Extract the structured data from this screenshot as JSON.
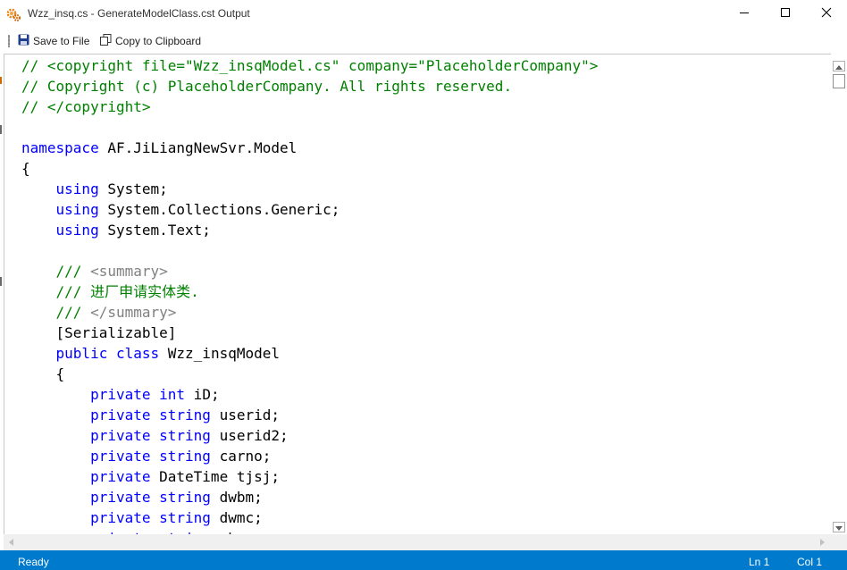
{
  "window": {
    "title": "Wzz_insq.cs - GenerateModelClass.cst Output",
    "icon": "gears-icon",
    "controls": [
      "minimize-icon",
      "maximize-icon",
      "close-icon"
    ]
  },
  "toolbar": {
    "save_label": "Save to File",
    "save_icon": "floppy-disk-icon",
    "copy_label": "Copy to Clipboard",
    "copy_icon": "copy-icon"
  },
  "editor": {
    "lines": [
      [
        {
          "t": "// <copyright file=\"Wzz_insqModel.cs\" company=\"PlaceholderCompany\">",
          "c": "c"
        }
      ],
      [
        {
          "t": "// Copyright (c) PlaceholderCompany. All rights reserved.",
          "c": "c"
        }
      ],
      [
        {
          "t": "// </copyright>",
          "c": "c"
        }
      ],
      [],
      [
        {
          "t": "namespace",
          "c": "k"
        },
        {
          "t": " AF.JiLiangNewSvr.Model",
          "c": ""
        }
      ],
      [
        {
          "t": "{",
          "c": ""
        }
      ],
      [
        {
          "t": "    ",
          "c": ""
        },
        {
          "t": "using",
          "c": "k"
        },
        {
          "t": " System;",
          "c": ""
        }
      ],
      [
        {
          "t": "    ",
          "c": ""
        },
        {
          "t": "using",
          "c": "k"
        },
        {
          "t": " System.Collections.Generic;",
          "c": ""
        }
      ],
      [
        {
          "t": "    ",
          "c": ""
        },
        {
          "t": "using",
          "c": "k"
        },
        {
          "t": " System.Text;",
          "c": ""
        }
      ],
      [],
      [
        {
          "t": "    ",
          "c": ""
        },
        {
          "t": "/// ",
          "c": "c"
        },
        {
          "t": "<summary>",
          "c": "g"
        }
      ],
      [
        {
          "t": "    ",
          "c": ""
        },
        {
          "t": "/// 进厂申请实体类.",
          "c": "c"
        }
      ],
      [
        {
          "t": "    ",
          "c": ""
        },
        {
          "t": "/// ",
          "c": "c"
        },
        {
          "t": "</summary>",
          "c": "g"
        }
      ],
      [
        {
          "t": "    [Serializable]",
          "c": ""
        }
      ],
      [
        {
          "t": "    ",
          "c": ""
        },
        {
          "t": "public",
          "c": "k"
        },
        {
          "t": " ",
          "c": ""
        },
        {
          "t": "class",
          "c": "k"
        },
        {
          "t": " Wzz_insqModel",
          "c": ""
        }
      ],
      [
        {
          "t": "    {",
          "c": ""
        }
      ],
      [
        {
          "t": "        ",
          "c": ""
        },
        {
          "t": "private",
          "c": "k"
        },
        {
          "t": " ",
          "c": ""
        },
        {
          "t": "int",
          "c": "k"
        },
        {
          "t": " iD;",
          "c": ""
        }
      ],
      [
        {
          "t": "        ",
          "c": ""
        },
        {
          "t": "private",
          "c": "k"
        },
        {
          "t": " ",
          "c": ""
        },
        {
          "t": "string",
          "c": "k"
        },
        {
          "t": " userid;",
          "c": ""
        }
      ],
      [
        {
          "t": "        ",
          "c": ""
        },
        {
          "t": "private",
          "c": "k"
        },
        {
          "t": " ",
          "c": ""
        },
        {
          "t": "string",
          "c": "k"
        },
        {
          "t": " userid2;",
          "c": ""
        }
      ],
      [
        {
          "t": "        ",
          "c": ""
        },
        {
          "t": "private",
          "c": "k"
        },
        {
          "t": " ",
          "c": ""
        },
        {
          "t": "string",
          "c": "k"
        },
        {
          "t": " carno;",
          "c": ""
        }
      ],
      [
        {
          "t": "        ",
          "c": ""
        },
        {
          "t": "private",
          "c": "k"
        },
        {
          "t": " DateTime tjsj;",
          "c": ""
        }
      ],
      [
        {
          "t": "        ",
          "c": ""
        },
        {
          "t": "private",
          "c": "k"
        },
        {
          "t": " ",
          "c": ""
        },
        {
          "t": "string",
          "c": "k"
        },
        {
          "t": " dwbm;",
          "c": ""
        }
      ],
      [
        {
          "t": "        ",
          "c": ""
        },
        {
          "t": "private",
          "c": "k"
        },
        {
          "t": " ",
          "c": ""
        },
        {
          "t": "string",
          "c": "k"
        },
        {
          "t": " dwmc;",
          "c": ""
        }
      ],
      [
        {
          "t": "        ",
          "c": ""
        },
        {
          "t": "private",
          "c": "k"
        },
        {
          "t": " ",
          "c": ""
        },
        {
          "t": "string",
          "c": "k"
        },
        {
          "t": " cbr;",
          "c": ""
        }
      ]
    ]
  },
  "statusbar": {
    "status": "Ready",
    "line": "Ln 1",
    "column": "Col 1"
  },
  "colors": {
    "comment": "#008000",
    "keyword": "#0000ff",
    "xml_tag": "#808080",
    "statusbar": "#007acc"
  }
}
